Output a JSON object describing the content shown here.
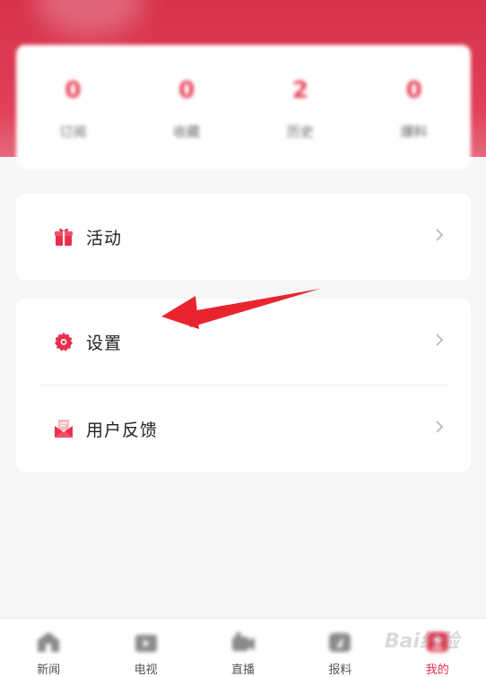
{
  "stats": [
    {
      "value": "0",
      "label": "订阅"
    },
    {
      "value": "0",
      "label": "收藏"
    },
    {
      "value": "2",
      "label": "历史"
    },
    {
      "value": "0",
      "label": "爆料"
    }
  ],
  "menu": {
    "activity_label": "活动",
    "settings_label": "设置",
    "feedback_label": "用户反馈"
  },
  "tabs": [
    {
      "label": "新闻",
      "icon": "home-icon"
    },
    {
      "label": "电视",
      "icon": "tv-icon"
    },
    {
      "label": "直播",
      "icon": "camera-icon"
    },
    {
      "label": "报料",
      "icon": "report-icon"
    },
    {
      "label": "我的",
      "icon": "profile-icon"
    }
  ],
  "watermark": "Bai经验",
  "colors": {
    "accent": "#e8304a",
    "header": "#d7324c"
  }
}
